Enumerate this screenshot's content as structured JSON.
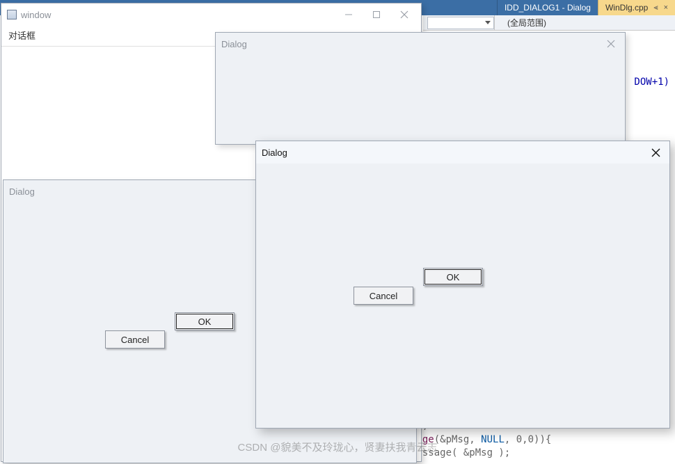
{
  "ide": {
    "tabs": [
      {
        "label": "IDD_DIALOG1 - Dialog"
      },
      {
        "label": "WinDlg.cpp"
      }
    ],
    "scope_dropdown": "",
    "scope_label": "(全局范围)",
    "code_fragment_right": "DOW+1)",
    "code_bottom_line1_fn": "sage",
    "code_bottom_line1_args_open": "(&pMsg, ",
    "code_bottom_line1_null": "NULL",
    "code_bottom_line1_args_close": ", 0,0)){",
    "code_bottom_line2": "Message( &pMsg );"
  },
  "main_window": {
    "title": "window",
    "subtitle": "对话框",
    "controls": {
      "minimize": "—",
      "maximize": "□",
      "close": "×"
    }
  },
  "dialog1": {
    "title": "Dialog"
  },
  "dialog2": {
    "title": "Dialog",
    "ok_label": "OK",
    "cancel_label": "Cancel"
  },
  "dialog3": {
    "title": "Dialog",
    "ok_label": "OK",
    "cancel_label": "Cancel"
  },
  "watermark": "CSDN @貌美不及玲珑心，贤妻扶我青云志"
}
